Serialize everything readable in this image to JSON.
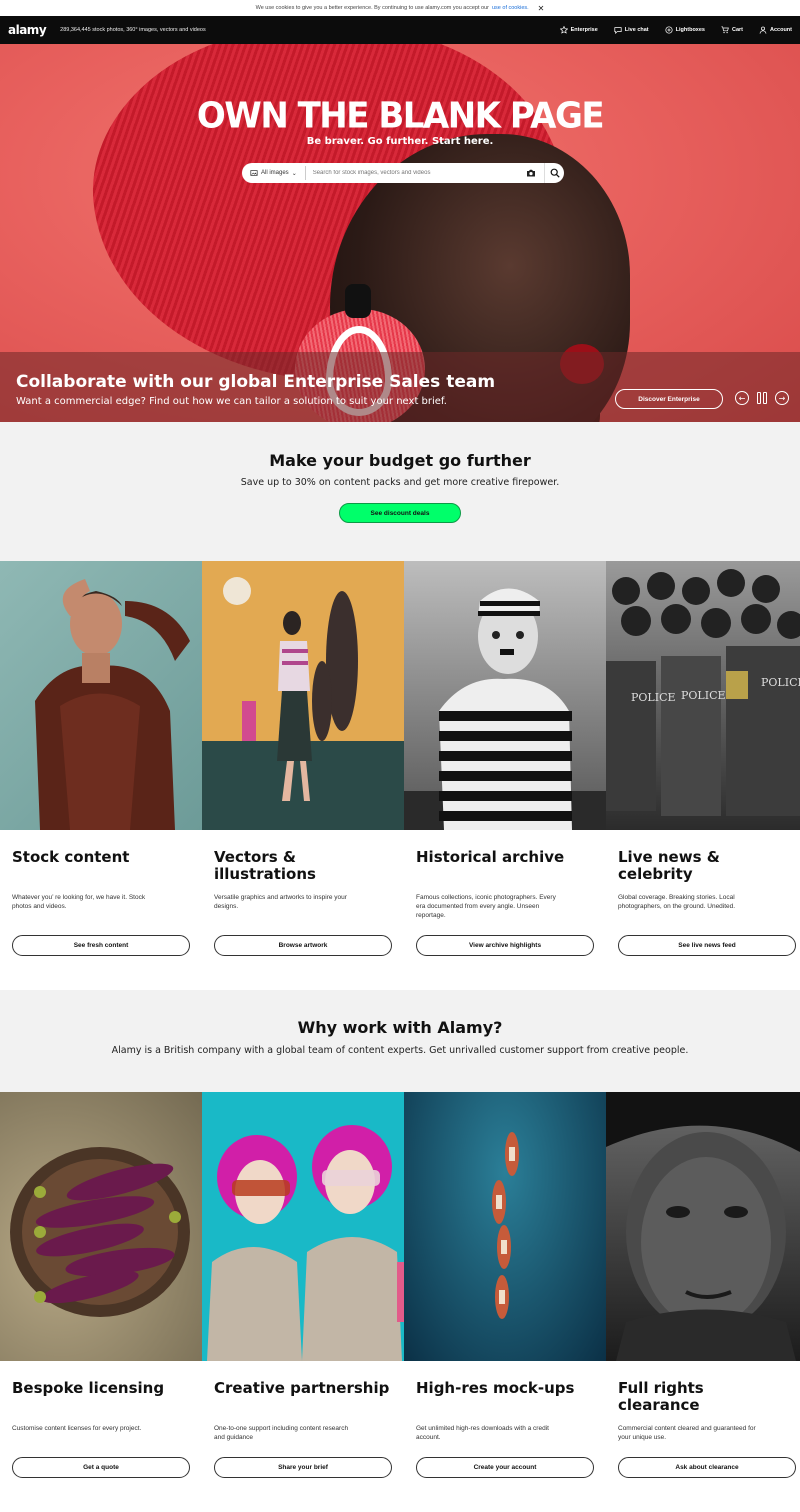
{
  "cookie": {
    "text": "We use cookies to give you a better experience. By continuing to use alamy.com you accept our",
    "link": "use of cookies."
  },
  "nav": {
    "logo": "alamy",
    "tagline": "289,364,445 stock photos, 360° images, vectors and videos",
    "links": [
      "Enterprise",
      "Live chat",
      "Lightboxes",
      "Cart",
      "Account"
    ]
  },
  "hero": {
    "title": "OWN THE BLANK PAGE",
    "subtitle": "Be braver. Go further. Start here.",
    "search_category": "All images",
    "search_placeholder": "Search for stock images, vectors and videos",
    "bar_title": "Collaborate with our global Enterprise Sales team",
    "bar_sub": "Want a commercial edge? Find out how we can tailor a solution to suit your next brief.",
    "cta": "Discover Enterprise"
  },
  "budget": {
    "title": "Make your budget go further",
    "text": "Save up to 30% on content packs and get more creative firepower.",
    "cta": "See discount deals"
  },
  "content_cards": [
    {
      "title": "Stock content",
      "text": "Whatever you’  re looking for, we have it. Stock photos and videos.",
      "cta": "See fresh content"
    },
    {
      "title": "Vectors & illustrations",
      "text": "Versatile graphics and artworks to inspire your designs.",
      "cta": "Browse artwork"
    },
    {
      "title": "Historical archive",
      "text": "Famous collections, iconic photographers. Every era documented from every angle. Unseen reportage.",
      "cta": "View archive highlights"
    },
    {
      "title": "Live news & celebrity",
      "text": "Global coverage. Breaking stories. Local photographers, on the ground. Unedited.",
      "cta": "See live news feed"
    }
  ],
  "why": {
    "title": "Why work with Alamy?",
    "text": "Alamy is a British company with a global team of content experts. Get unrivalled customer support from creative people."
  },
  "why_cards": [
    {
      "title": "Bespoke licensing",
      "text": "Customise content licenses for every project.",
      "cta": "Get a quote"
    },
    {
      "title": "Creative partnership",
      "text": "One-to-one support including content research and guidance",
      "cta": "Share your brief"
    },
    {
      "title": "High-res mock-ups",
      "text": "Get unlimited high-res downloads with a credit account.",
      "cta": "Create your account"
    },
    {
      "title": "Full rights clearance",
      "text": "Commercial content cleared and guaranteed for your unique use.",
      "cta": "Ask about clearance"
    }
  ],
  "police_text": "POLICE"
}
